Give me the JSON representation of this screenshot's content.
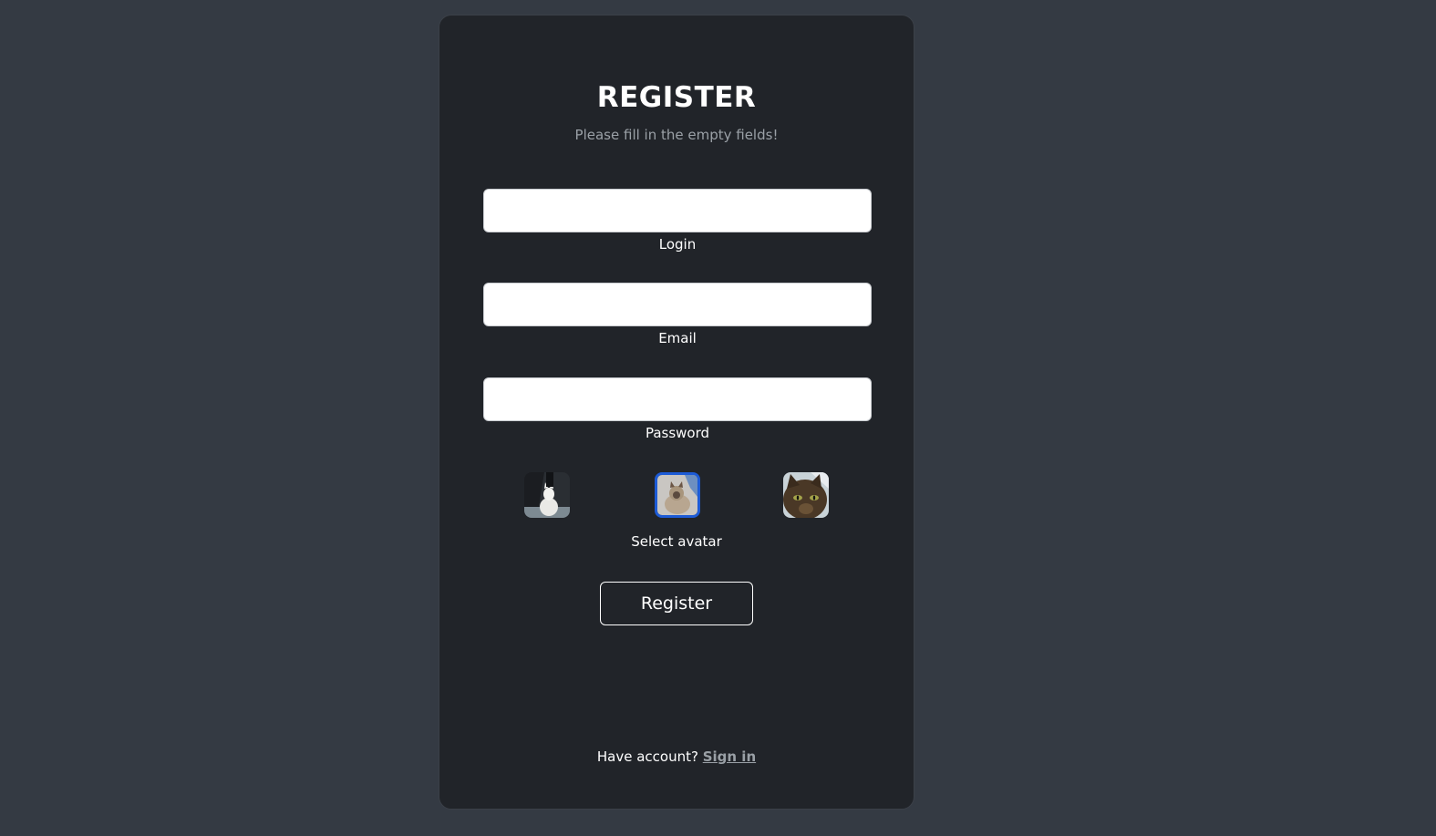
{
  "register": {
    "title": "REGISTER",
    "subtitle": "Please fill in the empty fields!",
    "fields": [
      {
        "label": "Login",
        "value": "",
        "placeholder": ""
      },
      {
        "label": "Email",
        "value": "",
        "placeholder": ""
      },
      {
        "label": "Password",
        "value": "",
        "placeholder": ""
      }
    ],
    "avatars": {
      "options": [
        "avatar-cat-white",
        "avatar-cat-siamese",
        "avatar-cat-tortoiseshell"
      ],
      "selected_index": 1,
      "label": "Select avatar"
    },
    "submit_label": "Register",
    "footer": {
      "prompt": "Have account?",
      "link_label": "Sign in"
    }
  },
  "colors": {
    "background": "#343a43",
    "card": "#212429",
    "selected_avatar_border": "#1d5bd6",
    "muted_text": "#9aa0a6"
  }
}
